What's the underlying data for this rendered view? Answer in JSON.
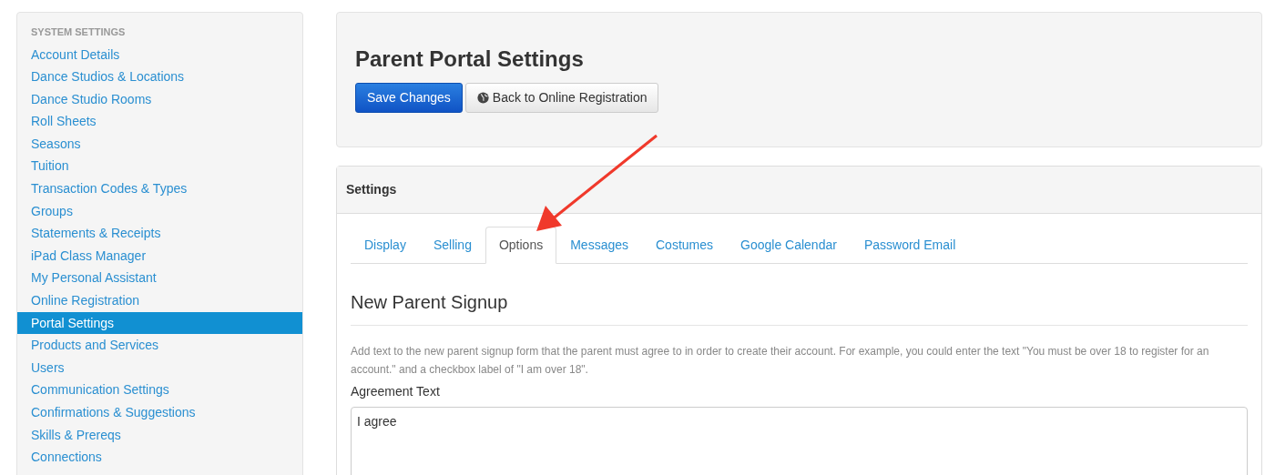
{
  "sidebar": {
    "heading": "SYSTEM SETTINGS",
    "items": [
      {
        "label": "Account Details",
        "selected": false
      },
      {
        "label": "Dance Studios & Locations",
        "selected": false
      },
      {
        "label": "Dance Studio Rooms",
        "selected": false
      },
      {
        "label": "Roll Sheets",
        "selected": false
      },
      {
        "label": "Seasons",
        "selected": false
      },
      {
        "label": "Tuition",
        "selected": false
      },
      {
        "label": "Transaction Codes & Types",
        "selected": false
      },
      {
        "label": "Groups",
        "selected": false
      },
      {
        "label": "Statements & Receipts",
        "selected": false
      },
      {
        "label": "iPad Class Manager",
        "selected": false
      },
      {
        "label": "My Personal Assistant",
        "selected": false
      },
      {
        "label": "Online Registration",
        "selected": false
      },
      {
        "label": "Portal Settings",
        "selected": true
      },
      {
        "label": "Products and Services",
        "selected": false
      },
      {
        "label": "Users",
        "selected": false
      },
      {
        "label": "Communication Settings",
        "selected": false
      },
      {
        "label": "Confirmations & Suggestions",
        "selected": false
      },
      {
        "label": "Skills & Prereqs",
        "selected": false
      },
      {
        "label": "Connections",
        "selected": false
      }
    ]
  },
  "header": {
    "title": "Parent Portal Settings",
    "buttons": [
      {
        "label": "Save Changes",
        "kind": "primary"
      },
      {
        "label": "Back to Online Registration",
        "kind": "globe"
      }
    ]
  },
  "settings": {
    "title": "Settings",
    "tabs": [
      {
        "label": "Display",
        "selected": false
      },
      {
        "label": "Selling",
        "selected": false
      },
      {
        "label": "Options",
        "selected": true
      },
      {
        "label": "Messages",
        "selected": false
      },
      {
        "label": "Costumes",
        "selected": false
      },
      {
        "label": "Google Calendar",
        "selected": false
      },
      {
        "label": "Password Email",
        "selected": false
      }
    ],
    "section_title": "New Parent Signup",
    "help_text": "Add text to the new parent signup form that the parent must agree to in order to create their account. For example, you could enter the text \"You must be over 18 to register for an account.\" and a checkbox label of \"I am over 18\".",
    "field": {
      "label": "Agreement Text",
      "value": "I agree"
    }
  },
  "annotation": {
    "kind": "arrow"
  }
}
